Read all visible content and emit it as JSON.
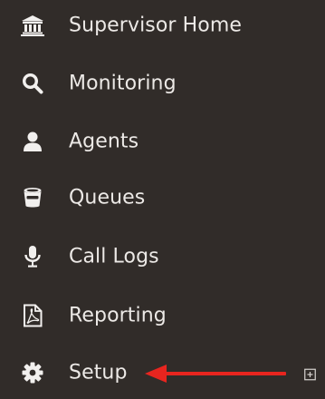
{
  "menu": {
    "items": [
      {
        "key": "supervisor-home",
        "label": "Supervisor Home",
        "icon": "bank-icon"
      },
      {
        "key": "monitoring",
        "label": "Monitoring",
        "icon": "search-icon"
      },
      {
        "key": "agents",
        "label": "Agents",
        "icon": "user-icon"
      },
      {
        "key": "queues",
        "label": "Queues",
        "icon": "bucket-icon"
      },
      {
        "key": "call-logs",
        "label": "Call Logs",
        "icon": "microphone-icon"
      },
      {
        "key": "reporting",
        "label": "Reporting",
        "icon": "pdf-file-icon"
      },
      {
        "key": "setup",
        "label": "Setup",
        "icon": "gear-icon",
        "expandable": true,
        "expand_icon": "plus-square-icon"
      }
    ]
  },
  "colors": {
    "background": "#312c29",
    "text": "#ece9e6",
    "icon": "#f2f0ee",
    "annotation_arrow": "#e8251f"
  },
  "annotation": {
    "icon": "red-arrow-icon",
    "points_to": "Setup"
  }
}
